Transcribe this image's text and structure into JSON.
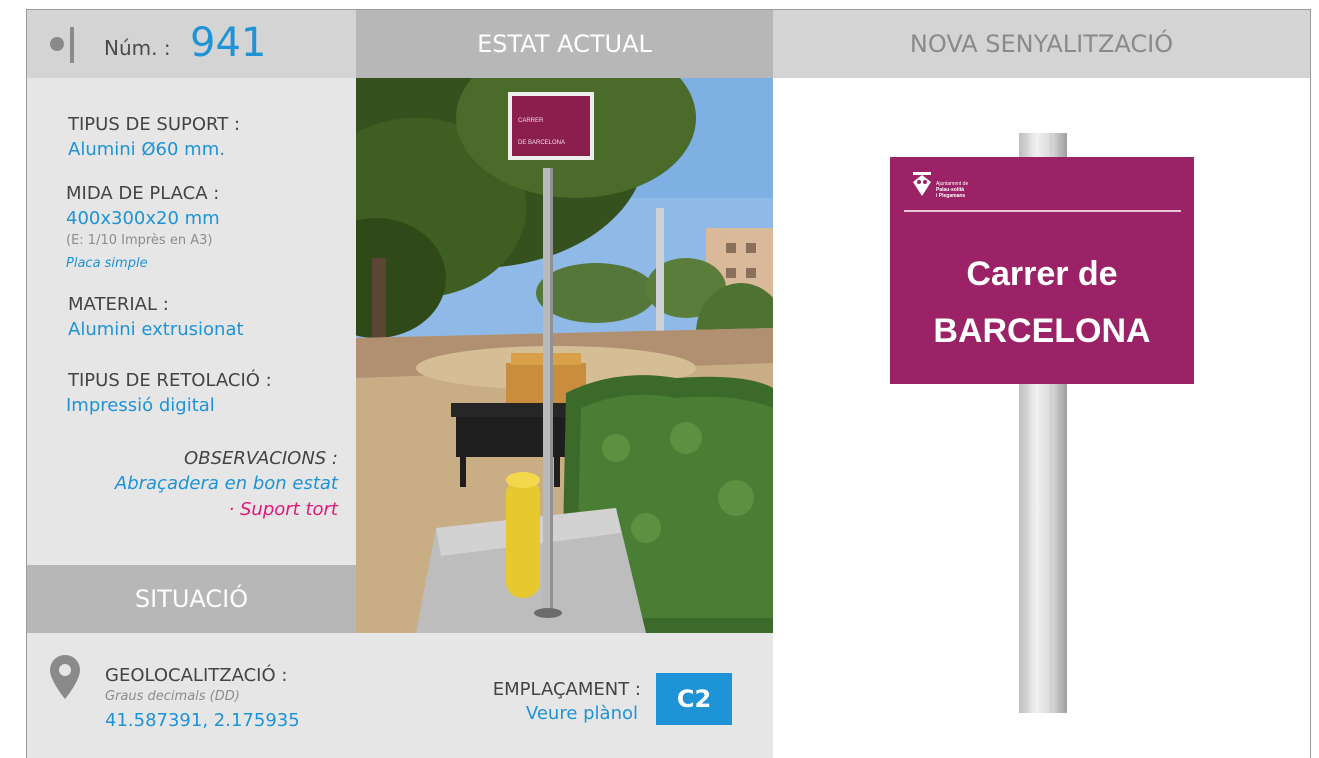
{
  "header": {
    "num_label": "Núm. :",
    "num_value": "941",
    "estat_actual": "ESTAT ACTUAL",
    "nova_senyalitzacio": "NOVA SENYALITZACIÓ"
  },
  "specs": {
    "tipus_suport_label": "TIPUS DE SUPORT :",
    "tipus_suport_value": "Alumini Ø60 mm.",
    "mida_placa_label": "MIDA DE PLACA :",
    "mida_placa_value": "400x300x20 mm",
    "mida_placa_note": "(E: 1/10 Imprès en A3)",
    "mida_placa_type": "Placa simple",
    "material_label": "MATERIAL :",
    "material_value": "Alumini extrusionat",
    "retolacio_label": "TIPUS DE RETOLACIÓ :",
    "retolacio_value": "Impressió digital",
    "observacions_label": "OBSERVACIONS :",
    "observacions_1": "Abraçadera en bon estat",
    "observacions_2": "· Suport tort"
  },
  "situacio": {
    "title": "SITUACIÓ",
    "geo_label": "GEOLOCALITZACIÓ :",
    "geo_format": "Graus decimals (DD)",
    "geo_value": "41.587391, 2.175935",
    "emplacament_label": "EMPLAÇAMENT :",
    "emplacament_link": "Veure plànol",
    "emplacament_code": "C2"
  },
  "photo_sign": {
    "line1": "CARRER",
    "line2": "DE BARCELONA"
  },
  "new_sign": {
    "logo_line1": "Ajuntament de",
    "logo_line2": "Palau-solità",
    "logo_line3": "i Plegamans",
    "line1": "Carrer de",
    "line2": "BARCELONA",
    "color": "#9b2266"
  },
  "colors": {
    "accent_blue": "#1e93d6",
    "pink": "#e0197a",
    "panel_gray": "#e6e6e6",
    "header_gray": "#b7b7b7"
  }
}
